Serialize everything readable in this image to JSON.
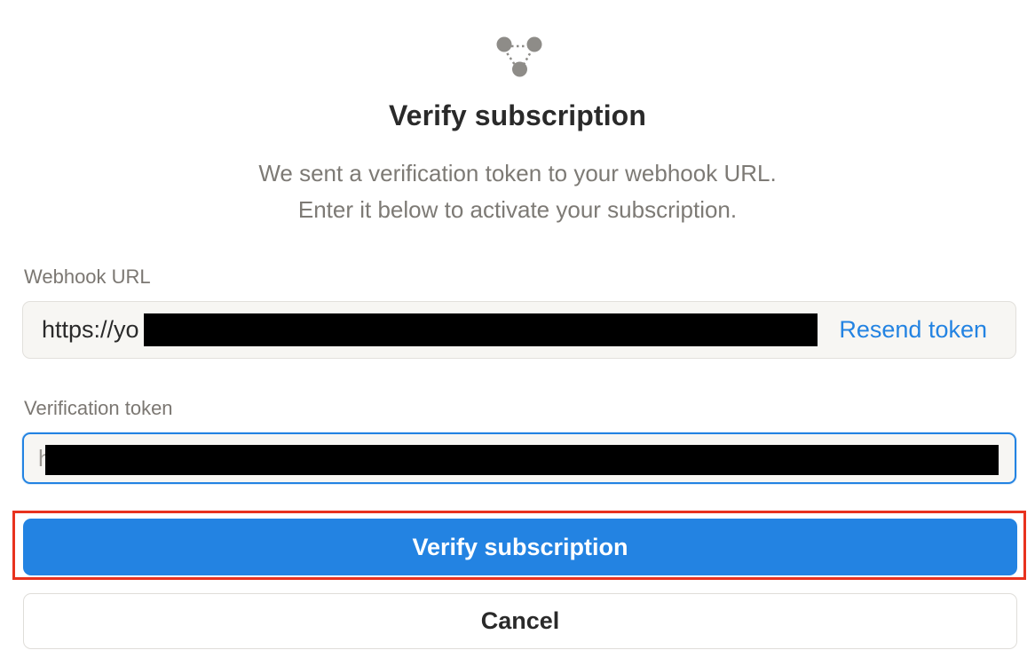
{
  "dialog": {
    "icon": "webhook-icon",
    "title": "Verify subscription",
    "subtitle_line1": "We sent a verification token to your webhook URL.",
    "subtitle_line2": "Enter it below to activate your subscription."
  },
  "webhook_url": {
    "label": "Webhook URL",
    "value": "https://yo",
    "resend_label": "Resend token"
  },
  "verification_token": {
    "label": "Verification token",
    "value": "h"
  },
  "actions": {
    "verify_label": "Verify subscription",
    "cancel_label": "Cancel"
  },
  "colors": {
    "accent": "#2383e2",
    "highlight": "#e8321e"
  }
}
